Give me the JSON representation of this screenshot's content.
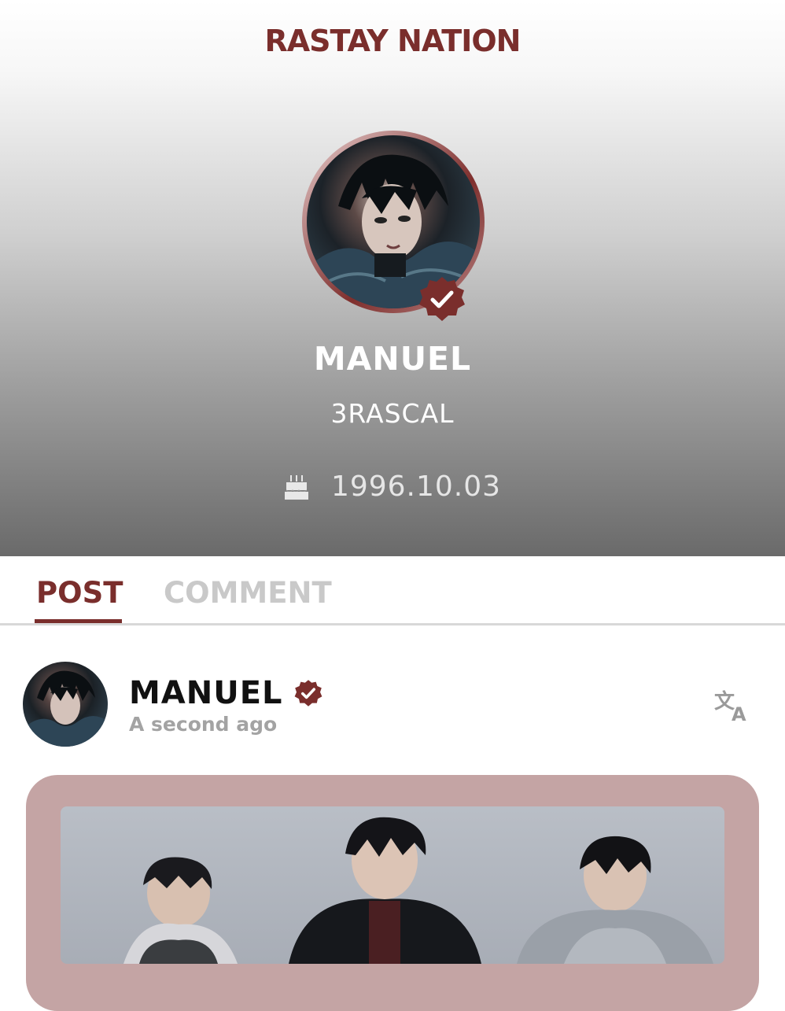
{
  "header": {
    "brand": "RASTAY NATION",
    "profile": {
      "name": "MANUEL",
      "group": "3RASCAL",
      "birthday": "1996.10.03",
      "avatar_icon": "profile-photo",
      "verified_icon": "verified-badge-icon",
      "birthday_icon": "cake-icon"
    }
  },
  "tabs": [
    {
      "label": "POST",
      "active": true
    },
    {
      "label": "COMMENT",
      "active": false
    }
  ],
  "post": {
    "author": "MANUEL",
    "time": "A second ago",
    "translate_icon": "translate-icon"
  },
  "colors": {
    "accent": "#7a2e2c",
    "card_bg": "#c4a4a4",
    "tab_inactive": "#c9c9c9"
  }
}
